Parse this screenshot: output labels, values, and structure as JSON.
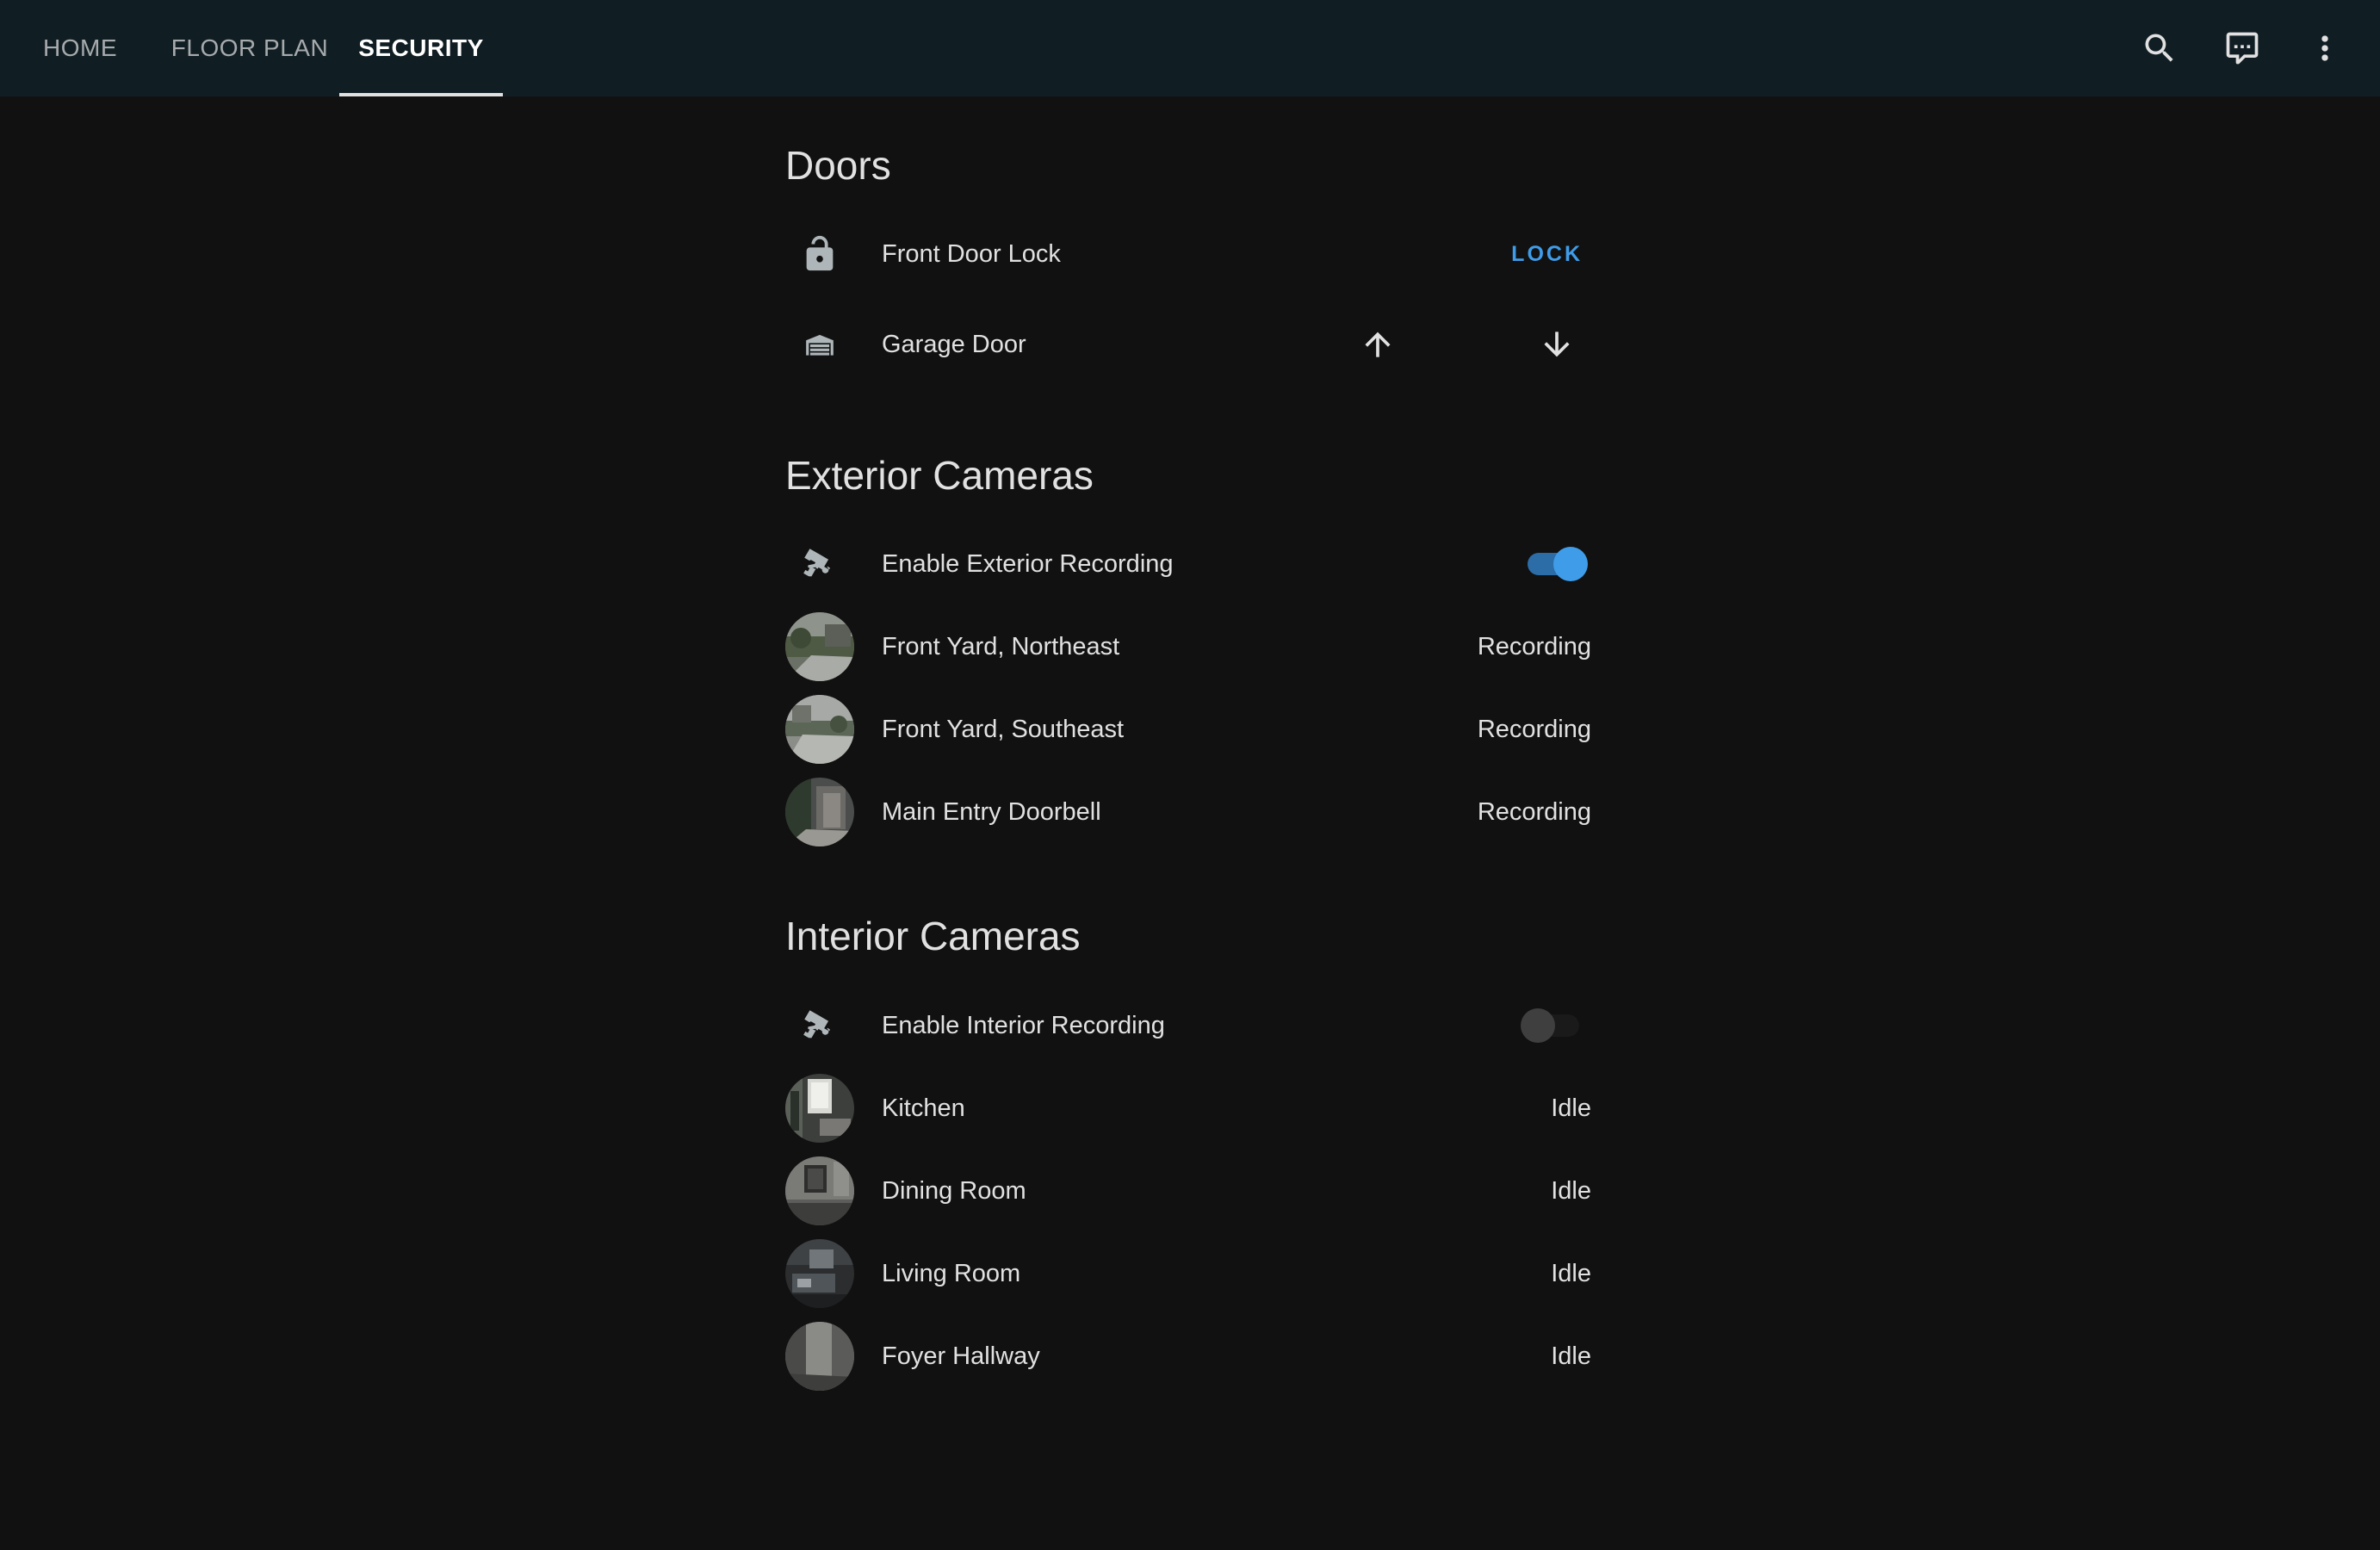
{
  "header": {
    "tabs": [
      {
        "label": "HOME",
        "active": false
      },
      {
        "label": "FLOOR PLAN",
        "active": false
      },
      {
        "label": "SECURITY",
        "active": true
      }
    ],
    "actions": [
      {
        "icon": "search-icon"
      },
      {
        "icon": "assist-chat-icon"
      },
      {
        "icon": "more-vertical-icon"
      }
    ]
  },
  "doors": {
    "title": "Doors",
    "front_door": {
      "label": "Front Door Lock",
      "action_label": "LOCK",
      "icon": "lock-open-icon"
    },
    "garage_door": {
      "label": "Garage Door",
      "icon": "garage-icon",
      "up_icon": "arrow-up-icon",
      "down_icon": "arrow-down-icon"
    }
  },
  "exterior": {
    "title": "Exterior Cameras",
    "toggle": {
      "label": "Enable Exterior Recording",
      "state": true,
      "icon": "cctv-icon"
    },
    "cameras": [
      {
        "label": "Front Yard, Northeast",
        "state": "Recording"
      },
      {
        "label": "Front Yard, Southeast",
        "state": "Recording"
      },
      {
        "label": "Main Entry Doorbell",
        "state": "Recording"
      }
    ]
  },
  "interior": {
    "title": "Interior Cameras",
    "toggle": {
      "label": "Enable Interior Recording",
      "state": false,
      "icon": "cctv-icon"
    },
    "cameras": [
      {
        "label": "Kitchen",
        "state": "Idle"
      },
      {
        "label": "Dining Room",
        "state": "Idle"
      },
      {
        "label": "Living Room",
        "state": "Idle"
      },
      {
        "label": "Foyer Hallway",
        "state": "Idle"
      }
    ]
  },
  "colors": {
    "background": "#111111",
    "header": "#101e24",
    "accent": "#3f9ce8",
    "text": "#e1e1e1"
  }
}
